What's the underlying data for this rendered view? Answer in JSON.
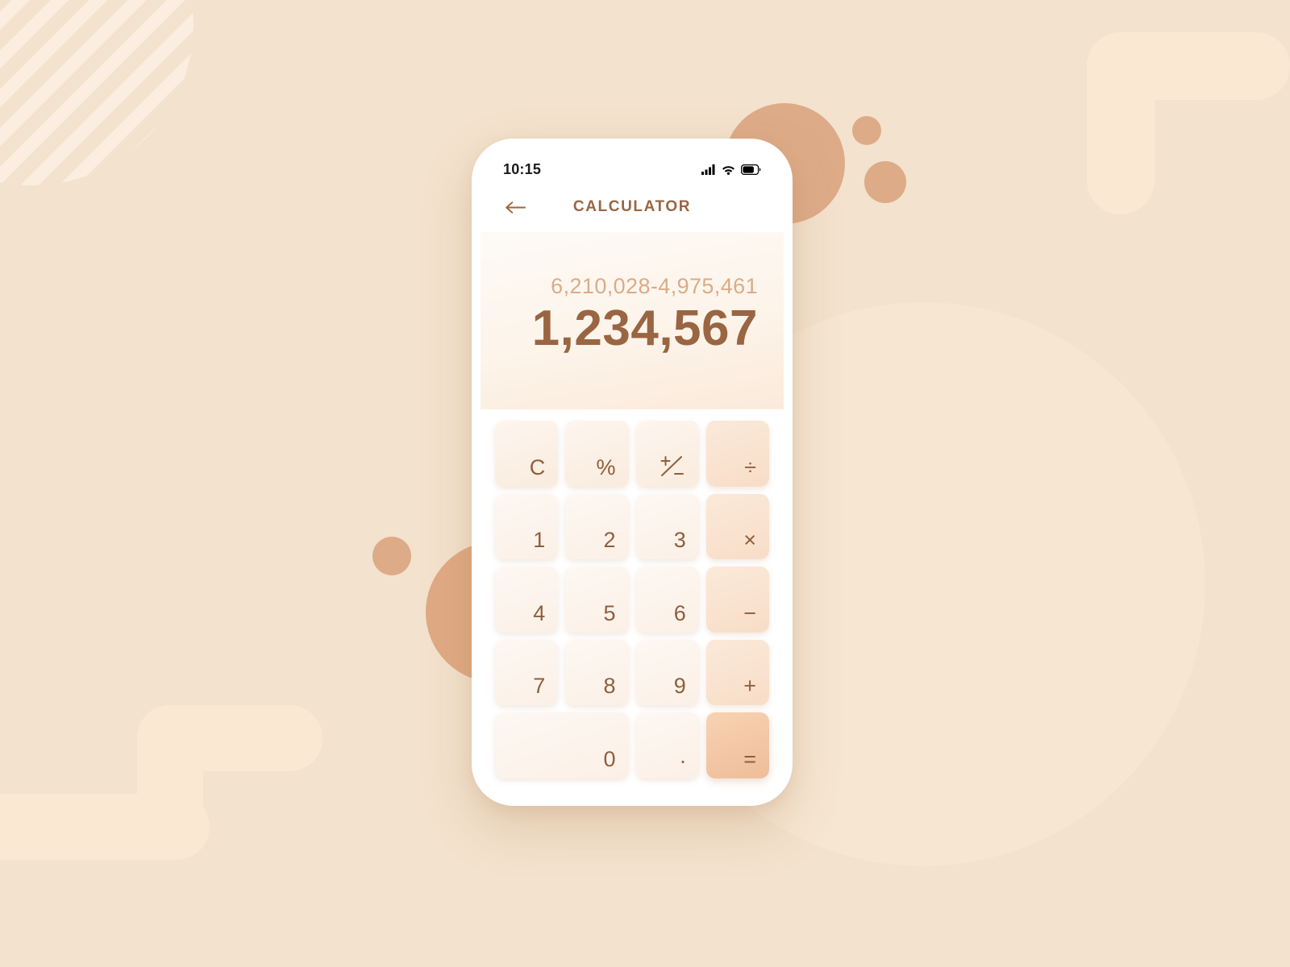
{
  "theme": {
    "background": "#f3e2cd",
    "shape_light": "#fae8d3",
    "shape_tan": "#ddab87",
    "accent_brown": "#9a6542",
    "expression_color": "#dcab86",
    "equals_key": "#efbd99"
  },
  "status_bar": {
    "time": "10:15",
    "signal_icon": "cellular-signal-icon",
    "wifi_icon": "wifi-icon",
    "battery_icon": "battery-icon"
  },
  "header": {
    "back_icon": "back-arrow-icon",
    "title": "CALCULATOR"
  },
  "display": {
    "expression": "6,210,028-4,975,461",
    "result": "1,234,567"
  },
  "keypad": {
    "rows": [
      [
        {
          "label": "C",
          "name": "clear",
          "type": "fn"
        },
        {
          "label": "%",
          "name": "percent",
          "type": "fn"
        },
        {
          "label": "+/-",
          "name": "plus-minus",
          "type": "fn"
        },
        {
          "label": "÷",
          "name": "divide",
          "type": "op"
        }
      ],
      [
        {
          "label": "1",
          "name": "digit-1",
          "type": "num"
        },
        {
          "label": "2",
          "name": "digit-2",
          "type": "num"
        },
        {
          "label": "3",
          "name": "digit-3",
          "type": "num"
        },
        {
          "label": "×",
          "name": "multiply",
          "type": "op"
        }
      ],
      [
        {
          "label": "4",
          "name": "digit-4",
          "type": "num"
        },
        {
          "label": "5",
          "name": "digit-5",
          "type": "num"
        },
        {
          "label": "6",
          "name": "digit-6",
          "type": "num"
        },
        {
          "label": "−",
          "name": "subtract",
          "type": "op"
        }
      ],
      [
        {
          "label": "7",
          "name": "digit-7",
          "type": "num"
        },
        {
          "label": "8",
          "name": "digit-8",
          "type": "num"
        },
        {
          "label": "9",
          "name": "digit-9",
          "type": "num"
        },
        {
          "label": "+",
          "name": "add",
          "type": "op"
        }
      ],
      [
        {
          "label": "0",
          "name": "digit-0",
          "type": "num",
          "wide": true
        },
        {
          "label": ".",
          "name": "decimal-point",
          "type": "num"
        },
        {
          "label": "=",
          "name": "equals",
          "type": "eq"
        }
      ]
    ]
  }
}
